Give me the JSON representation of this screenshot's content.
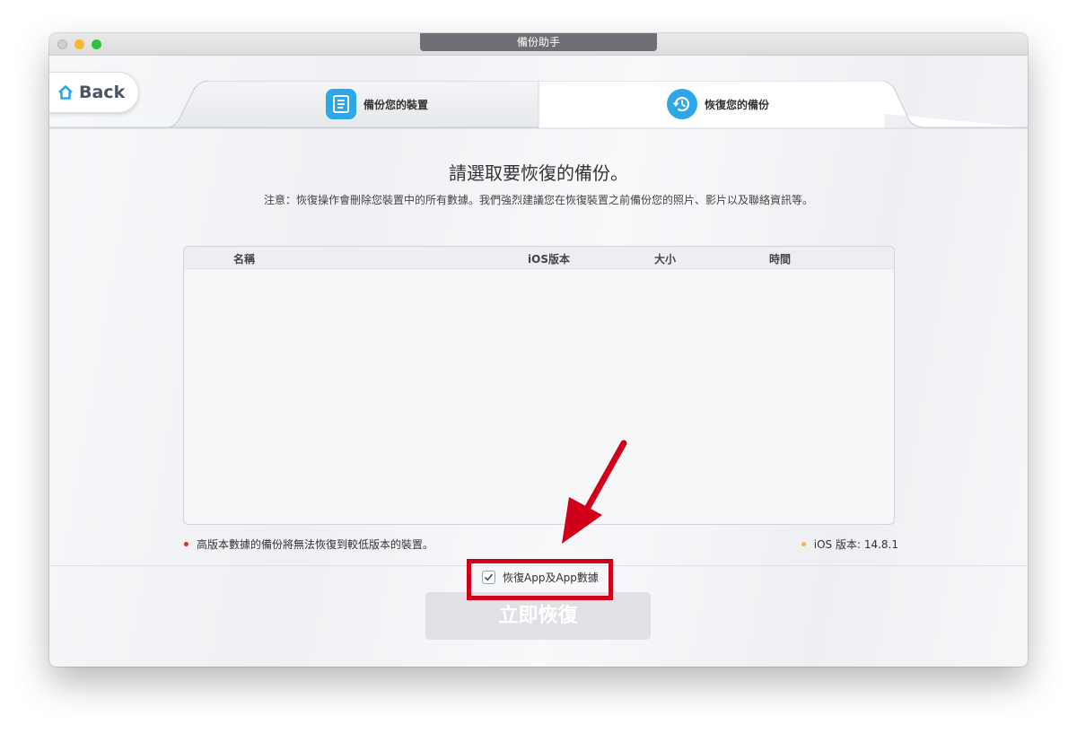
{
  "window": {
    "title": "備份助手"
  },
  "nav": {
    "back_label": "Back"
  },
  "tabs": [
    {
      "label": "備份您的裝置",
      "icon": "document-icon"
    },
    {
      "label": "恢復您的備份",
      "icon": "restore-clock-icon"
    }
  ],
  "main": {
    "heading": "請選取要恢復的備份。",
    "notice": "注意：恢復操作會刪除您裝置中的所有數據。我們強烈建議您在恢復裝置之前備份您的照片、影片以及聯絡資訊等。"
  },
  "table": {
    "columns": [
      "名稱",
      "iOS版本",
      "大小",
      "時間"
    ],
    "rows": []
  },
  "footer": {
    "warning": "高版本數據的備份將無法恢復到較低版本的裝置。",
    "ios_version": "iOS 版本: 14.8.1",
    "checkbox_label": "恢復App及App數據",
    "checkbox_checked": true,
    "restore_button": "立即恢復"
  },
  "colors": {
    "accent": "#2ea7e8",
    "annotation_red": "#d0001b",
    "warning_dot": "#e22a2a",
    "info_dot": "#f5b82e"
  }
}
